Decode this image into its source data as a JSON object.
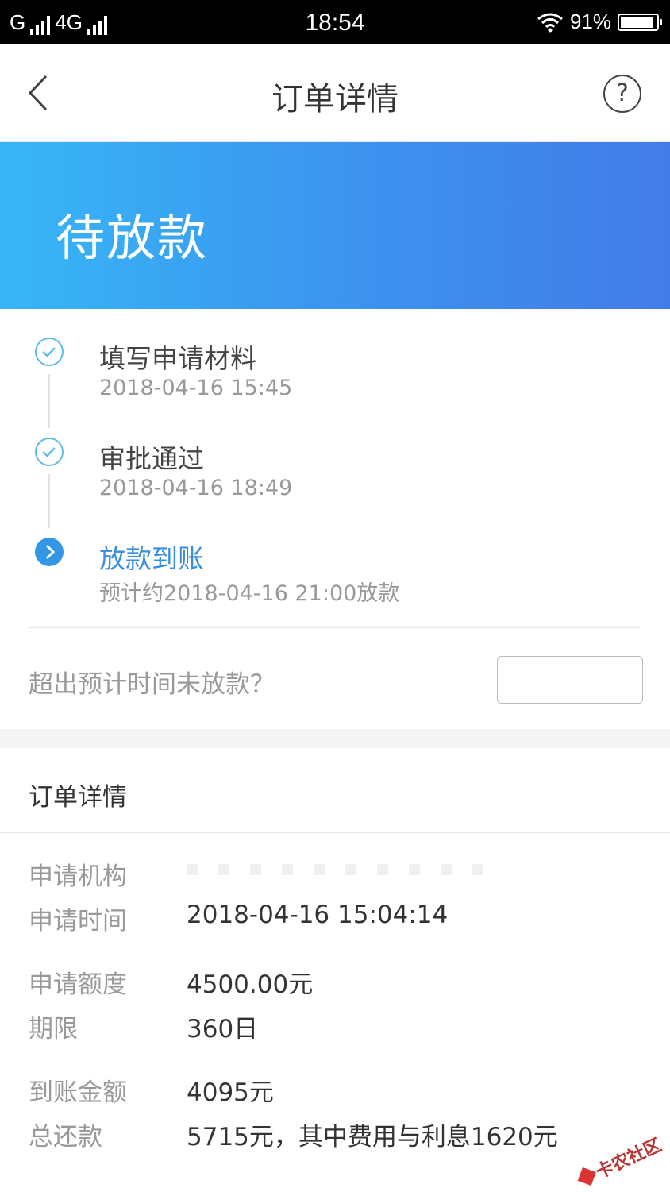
{
  "status_bar": {
    "carrier1": "G",
    "carrier2": "4G",
    "time": "18:54",
    "battery": "91%",
    "battery_level": 0.91
  },
  "navbar": {
    "title": "订单详情",
    "help_symbol": "?"
  },
  "banner": {
    "status": "待放款"
  },
  "timeline": [
    {
      "name": "填写申请材料",
      "time": "2018-04-16 15:45",
      "state": "done"
    },
    {
      "name": "审批通过",
      "time": "2018-04-16 18:49",
      "state": "done"
    },
    {
      "name": "放款到账",
      "time": "预计约2018-04-16 21:00放款",
      "state": "current"
    }
  ],
  "overdue": {
    "question": "超出预计时间未放款？"
  },
  "details": {
    "title": "订单详情",
    "rows": [
      {
        "label": "申请机构",
        "value": ""
      },
      {
        "label": "申请时间",
        "value": "2018-04-16 15:04:14"
      },
      {
        "label": "申请额度",
        "value": "4500.00元"
      },
      {
        "label": "期限",
        "value": "360日"
      },
      {
        "label": "到账金额",
        "value": "4095元"
      },
      {
        "label": "总还款",
        "value": "5715元，其中费用与利息1620元"
      }
    ]
  },
  "watermark": {
    "text": "卡农社区"
  },
  "colors": {
    "accent": "#3a8ee0",
    "banner_start": "#37b6f6",
    "banner_end": "#437ce8"
  }
}
